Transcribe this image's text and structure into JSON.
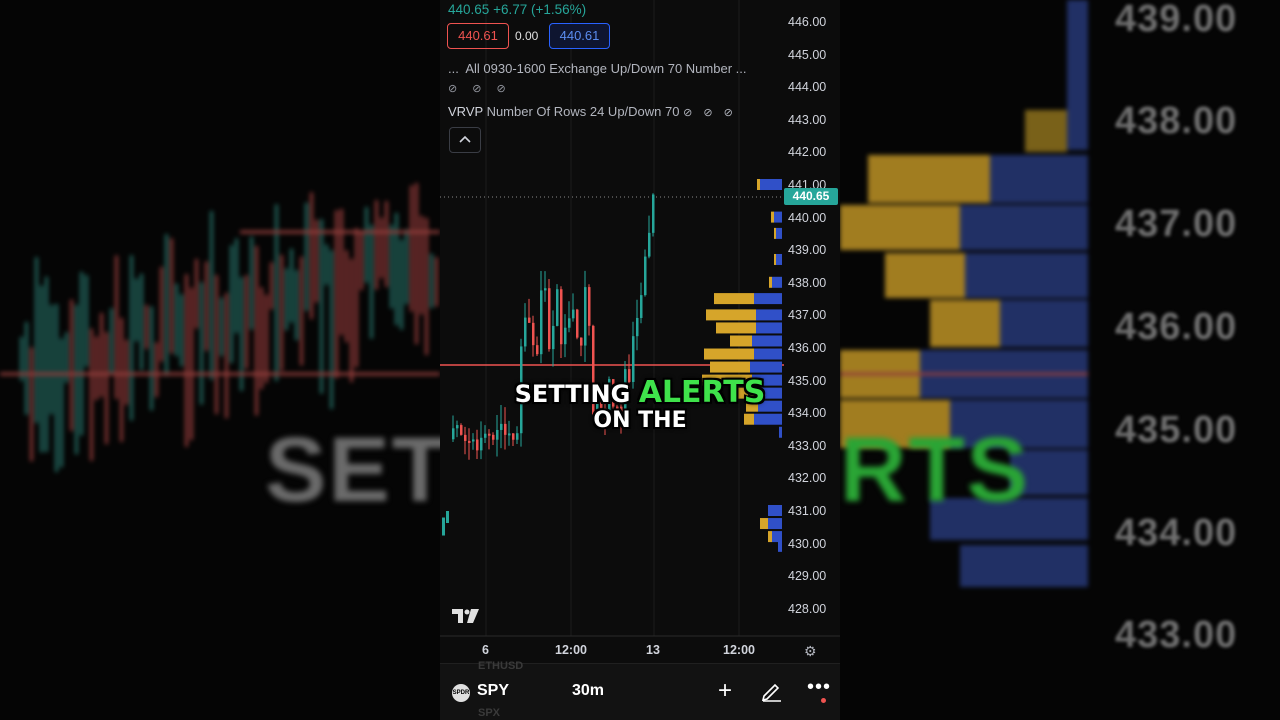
{
  "symbol": {
    "ticker": "SPY",
    "icon_text": "SPDR",
    "last_price": "440.65",
    "change": "+6.77 (+1.56%)",
    "bid": "440.61",
    "spread": "0.00",
    "ask": "440.61",
    "timeframe": "30m"
  },
  "indicators": {
    "session_volume": "All 0930-1600 Exchange Up/Down 70 Number ...",
    "session_prefix": "...",
    "session_icons": "⊘ ⊘ ⊘",
    "vrvp_name": "VRVP",
    "vrvp_params": "Number Of Rows 24 Up/Down 70",
    "vrvp_icons": "⊘ ⊘ ⊘",
    "collapse_icon": "chevron-up"
  },
  "y_axis": [
    "446.00",
    "445.00",
    "444.00",
    "443.00",
    "442.00",
    "441.00",
    "440.00",
    "439.00",
    "438.00",
    "437.00",
    "436.00",
    "435.00",
    "434.00",
    "433.00",
    "432.00",
    "431.00",
    "430.00",
    "429.00",
    "428.00"
  ],
  "current_price_tag": "440.65",
  "x_axis": [
    "6",
    "12:00",
    "13",
    "12:00"
  ],
  "caption": {
    "line1_a": "SETTING",
    "line1_b": "ALERTS",
    "line2": "ON THE"
  },
  "background": {
    "left_text": "SETTI",
    "right_text": "RTS",
    "right_prices": [
      "439.00",
      "438.00",
      "437.00",
      "436.00",
      "435.00",
      "434.00",
      "433.00"
    ]
  },
  "footer_ghost": {
    "top": "ETHUSD",
    "bottom": "SPX"
  },
  "colors": {
    "up": "#26a69a",
    "down": "#ef5350",
    "vp_up": "#3050c8",
    "vp_down": "#d6a52a",
    "accent_green": "#3fe24b",
    "ask_blue": "#2962ff"
  }
}
